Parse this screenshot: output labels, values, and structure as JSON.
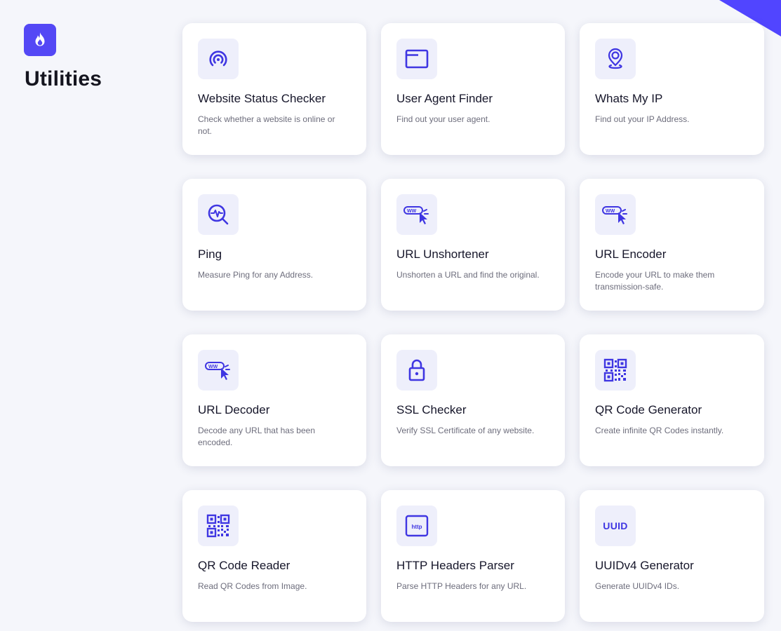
{
  "app": {
    "title": "Utilities",
    "logo_icon": "flame-icon",
    "accent_color": "#5145ff",
    "icon_color": "#3f36e2"
  },
  "tools": [
    {
      "icon": "signal-icon",
      "title": "Website Status Checker",
      "description": "Check whether a website is online or not."
    },
    {
      "icon": "browser-window-icon",
      "title": "User Agent Finder",
      "description": "Find out your user agent."
    },
    {
      "icon": "location-pin-icon",
      "title": "Whats My IP",
      "description": "Find out your IP Address."
    },
    {
      "icon": "search-pulse-icon",
      "title": "Ping",
      "description": "Measure Ping for any Address."
    },
    {
      "icon": "url-cursor-icon",
      "title": "URL Unshortener",
      "description": "Unshorten a URL and find the original."
    },
    {
      "icon": "url-cursor-icon",
      "title": "URL Encoder",
      "description": "Encode your URL to make them transmission-safe."
    },
    {
      "icon": "url-cursor-icon",
      "title": "URL Decoder",
      "description": "Decode any URL that has been encoded."
    },
    {
      "icon": "padlock-icon",
      "title": "SSL Checker",
      "description": "Verify SSL Certificate of any website."
    },
    {
      "icon": "qr-code-icon",
      "title": "QR Code Generator",
      "description": "Create infinite QR Codes instantly."
    },
    {
      "icon": "qr-code-icon",
      "title": "QR Code Reader",
      "description": "Read QR Codes from Image."
    },
    {
      "icon": "http-icon",
      "title": "HTTP Headers Parser",
      "description": "Parse HTTP Headers for any URL.",
      "icon_text": "http"
    },
    {
      "icon": "uuid-icon",
      "title": "UUIDv4 Generator",
      "description": "Generate UUIDv4 IDs.",
      "icon_text": "UUID"
    }
  ]
}
